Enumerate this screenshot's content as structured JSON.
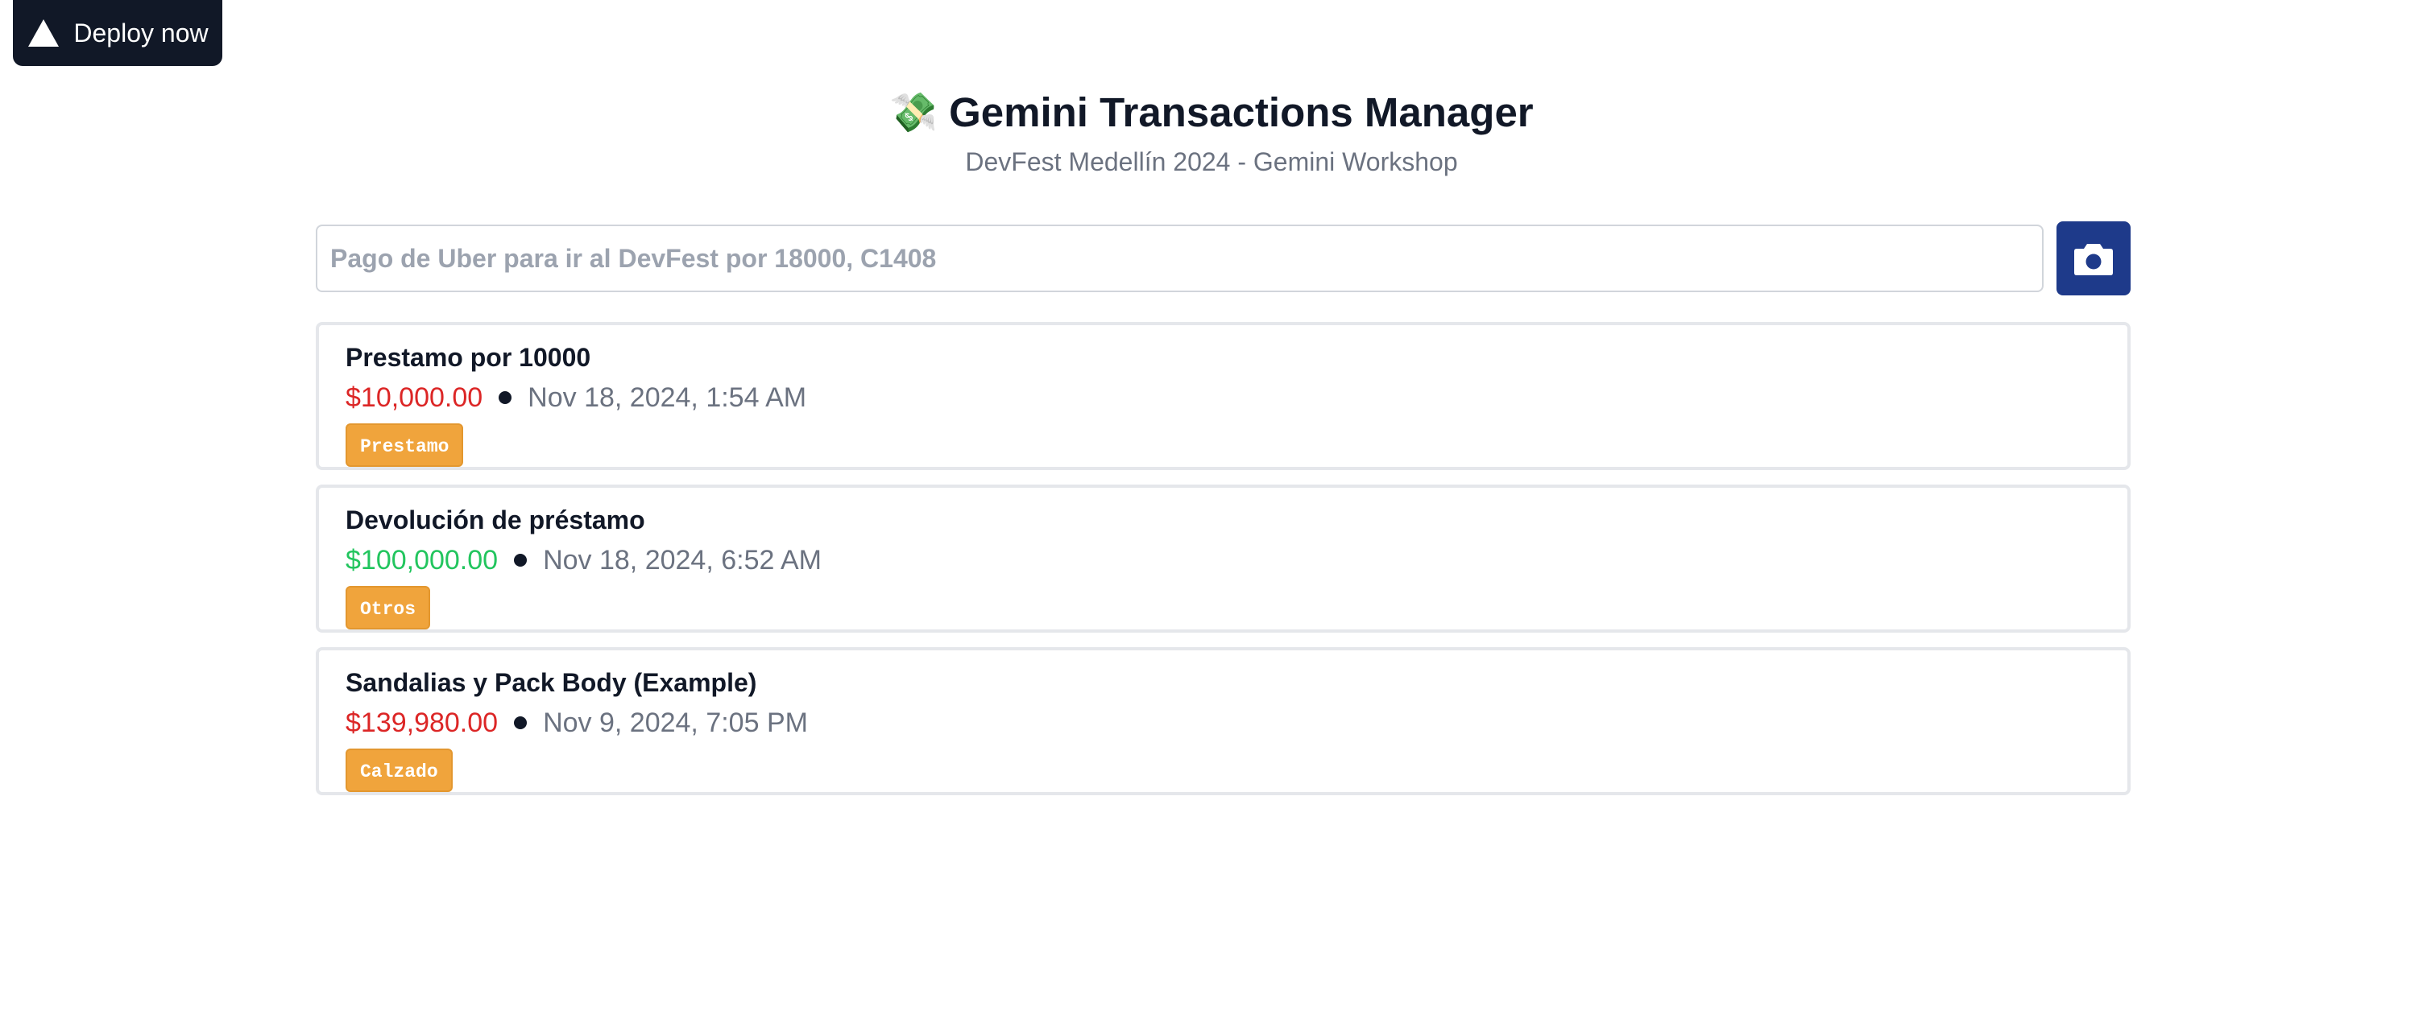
{
  "deploy": {
    "label": "Deploy now",
    "icon": "triangle-icon"
  },
  "header": {
    "icon": "💸",
    "title": "Gemini Transactions Manager",
    "subtitle": "DevFest Medellín 2024 - Gemini Workshop"
  },
  "input": {
    "placeholder": "Pago de Uber para ir al DevFest por 18000, C1408",
    "value": "",
    "camera_icon": "camera-icon"
  },
  "transactions": [
    {
      "title": "Prestamo por 10000",
      "amount": "$10,000.00",
      "type": "expense",
      "date": "Nov 18, 2024, 1:54 AM",
      "tag": "Prestamo"
    },
    {
      "title": "Devolución de préstamo",
      "amount": "$100,000.00",
      "type": "income",
      "date": "Nov 18, 2024, 6:52 AM",
      "tag": "Otros"
    },
    {
      "title": "Sandalias y Pack Body (Example)",
      "amount": "$139,980.00",
      "type": "expense",
      "date": "Nov 9, 2024, 7:05 PM",
      "tag": "Calzado"
    }
  ],
  "colors": {
    "expense": "#dc2626",
    "income": "#22c55e",
    "tag": "#f0a43c",
    "primary": "#1e3a8a"
  }
}
